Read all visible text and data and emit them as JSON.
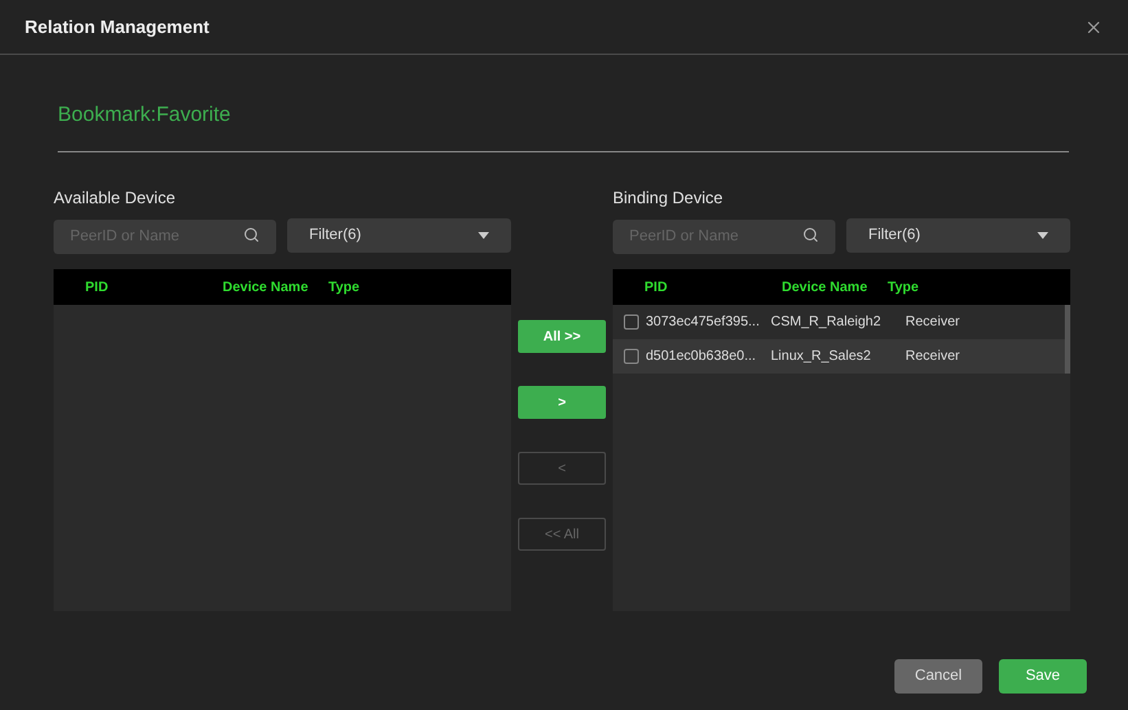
{
  "window": {
    "title": "Relation Management"
  },
  "bookmark": "Bookmark:Favorite",
  "available": {
    "label": "Available Device",
    "search": {
      "placeholder": "PeerID or Name"
    },
    "filter": "Filter(6)",
    "columns": [
      "PID",
      "Device Name",
      "Type"
    ]
  },
  "transfer_buttons": [
    {
      "label": "All >>",
      "disabled": false
    },
    {
      "label": ">",
      "disabled": false
    },
    {
      "label": "<",
      "disabled": true
    },
    {
      "label": "<< All",
      "disabled": true
    }
  ],
  "binding": {
    "label": "Binding Device",
    "search": {
      "placeholder": "PeerID or Name"
    },
    "filter": "Filter(6)",
    "columns": [
      "PID",
      "Device Name",
      "Type"
    ],
    "rows": [
      {
        "pid": "3073ec475ef395...",
        "name": "CSM_R_Raleigh2",
        "type": "Receiver",
        "checked": false,
        "selected": false
      },
      {
        "pid": "d501ec0b638e0...",
        "name": "Linux_R_Sales2",
        "type": "Receiver",
        "checked": false,
        "selected": true
      }
    ]
  },
  "footer": {
    "cancel": "Cancel",
    "save": "Save"
  }
}
